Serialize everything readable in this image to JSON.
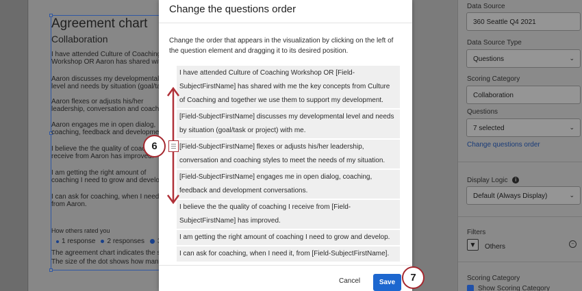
{
  "editor": {
    "chart_title": "Agreement chart",
    "chart_subtitle": "Collaboration",
    "questions": [
      "I have attended Culture of Coaching\nWorkshop OR Aaron has shared with",
      "Aaron discusses my developmental\nlevel and needs by situation (goal/tas",
      "Aaron flexes or adjusts his/her\nleadership, conversation and coachin",
      "Aaron engages me in open dialog,\ncoaching, feedback and development",
      "I believe the the quality of coachi\nreceive from Aaron has improved.",
      "I am getting the right amount of\ncoaching I need to grow and develop.",
      "I can ask for coaching, when I need it,\nfrom Aaron."
    ],
    "rated_label": "How others rated you",
    "legend": [
      "1 response",
      "2 responses",
      "3 r"
    ],
    "footer_lines": [
      "The agreement chart indicates the sir",
      "The size of the dot shows how many"
    ]
  },
  "sidebar": {
    "data_source_label": "Data Source",
    "data_source_value": "360 Seattle Q4 2021",
    "data_source_type_label": "Data Source Type",
    "data_source_type_value": "Questions",
    "scoring_category_label": "Scoring Category",
    "scoring_category_value": "Collaboration",
    "questions_label": "Questions",
    "questions_value": "7 selected",
    "change_order_link": "Change questions order",
    "display_logic_label": "Display Logic",
    "display_logic_value": "Default (Always Display)",
    "filters_label": "Filters",
    "filter_name": "Others",
    "scoring_category_label_2": "Scoring Category",
    "show_scoring_category": "Show Scoring Category"
  },
  "modal": {
    "title": "Change the questions order",
    "instructions": "Change the order that appears in the visualization by clicking on the left of the question element and dragging it to its desired position.",
    "questions": [
      "I have attended Culture of Coaching Workshop OR [Field-SubjectFirstName] has shared with me the key concepts from Culture of Coaching and together we use them to support my development.",
      "[Field-SubjectFirstName] discusses my developmental level and needs by situation (goal/task or project) with me.",
      "[Field-SubjectFirstName] flexes or adjusts his/her leadership, conversation and coaching styles to meet the needs of my situation.",
      "[Field-SubjectFirstName] engages me in open dialog, coaching, feedback and development conversations.",
      "I believe the the quality of coaching I receive from [Field-SubjectFirstName] has improved.",
      "I am getting the right amount of coaching I need to grow and develop.",
      "I can ask for coaching, when I need it, from [Field-SubjectFirstName]."
    ],
    "cancel": "Cancel",
    "save": "Save"
  },
  "callouts": {
    "step6": "6",
    "step7": "7"
  },
  "colors": {
    "accent": "#1d67cf",
    "callout_ring": "#a5272e",
    "arrow": "#b03038",
    "item_bg": "#efefef"
  }
}
